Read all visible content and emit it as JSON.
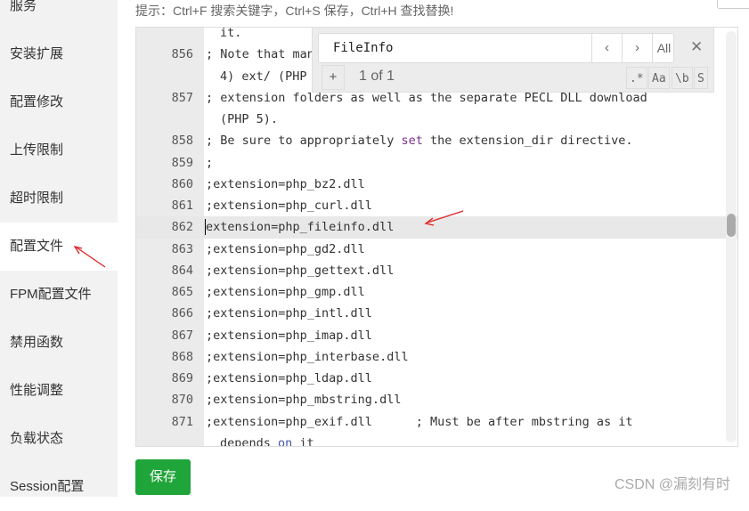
{
  "sidebar": {
    "items": [
      {
        "label": "服务"
      },
      {
        "label": "安装扩展"
      },
      {
        "label": "配置修改"
      },
      {
        "label": "上传限制"
      },
      {
        "label": "超时限制"
      },
      {
        "label": "配置文件",
        "active": true
      },
      {
        "label": "FPM配置文件"
      },
      {
        "label": "禁用函数"
      },
      {
        "label": "性能调整"
      },
      {
        "label": "负载状态"
      },
      {
        "label": "Session配置"
      }
    ]
  },
  "tip": "提示：Ctrl+F 搜索关键字，Ctrl+S 保存，Ctrl+H 查找替换!",
  "editor": {
    "lines": [
      {
        "n": "",
        "t": "it.",
        "cont": true
      },
      {
        "n": "856",
        "t": "; Note that many DLL files are located in the extensions/ (PHP"
      },
      {
        "n": "",
        "t": "4) ext/ (PHP",
        "cont": true
      },
      {
        "n": "857",
        "t": "; extension folders as well as the separate PECL DLL download"
      },
      {
        "n": "",
        "t": "(PHP 5).",
        "cont": true
      },
      {
        "n": "858",
        "t": "; Be sure to appropriately ",
        "kw": "set",
        "t2": " the extension_dir directive."
      },
      {
        "n": "859",
        "t": ";"
      },
      {
        "n": "860",
        "t": ";extension=php_bz2.dll"
      },
      {
        "n": "861",
        "t": ";extension=php_curl.dll"
      },
      {
        "n": "862",
        "t": "extension=php_fileinfo.dll",
        "active": true
      },
      {
        "n": "863",
        "t": ";extension=php_gd2.dll"
      },
      {
        "n": "864",
        "t": ";extension=php_gettext.dll"
      },
      {
        "n": "865",
        "t": ";extension=php_gmp.dll"
      },
      {
        "n": "866",
        "t": ";extension=php_intl.dll"
      },
      {
        "n": "867",
        "t": ";extension=php_imap.dll"
      },
      {
        "n": "868",
        "t": ";extension=php_interbase.dll"
      },
      {
        "n": "869",
        "t": ";extension=php_ldap.dll"
      },
      {
        "n": "870",
        "t": ";extension=php_mbstring.dll"
      },
      {
        "n": "871",
        "t": ";extension=php_exif.dll      ; Must be after mbstring as it"
      },
      {
        "n": "",
        "t": "depends ",
        "kw2": "on",
        "t2": " it",
        "cont": true
      }
    ]
  },
  "search": {
    "value": "FileInfo",
    "prev": "‹",
    "next": "›",
    "all": "All",
    "close": "✕",
    "plus": "+",
    "count": "1 of 1",
    "options": [
      ".*",
      "Aa",
      "\\b",
      "S"
    ]
  },
  "save_label": "保存",
  "watermark": "CSDN @漏刻有时",
  "colors": {
    "accent": "#20a53a",
    "annotation": "#e02020"
  }
}
